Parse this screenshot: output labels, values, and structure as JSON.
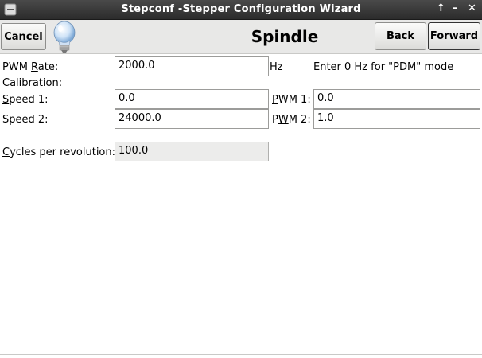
{
  "window": {
    "title": "Stepconf -Stepper Configuration Wizard",
    "controls": [
      "↑",
      "–",
      "✕"
    ]
  },
  "header": {
    "cancel_label": "Cancel",
    "page_title": "Spindle",
    "back_label": "Back",
    "forward_label": "Forward"
  },
  "form": {
    "pwm_rate": {
      "label_pre": "PWM ",
      "label_ul": "R",
      "label_post": "ate:",
      "value": "2000.0",
      "unit": "Hz",
      "hint": "Enter 0 Hz for \"PDM\" mode"
    },
    "calibration_label": "Calibration:",
    "speed1": {
      "label_ul": "S",
      "label_post": "peed 1:",
      "value": "0.0"
    },
    "pwm1": {
      "label_ul": "P",
      "label_post": "WM 1:",
      "value": "0.0"
    },
    "speed2": {
      "label": "Speed 2:",
      "value": "24000.0"
    },
    "pwm2": {
      "label_pre": "P",
      "label_ul": "W",
      "label_post": "M 2:",
      "value": "1.0"
    },
    "cycles": {
      "label_ul": "C",
      "label_post": "ycles per revolution:",
      "value": "100.0"
    }
  }
}
